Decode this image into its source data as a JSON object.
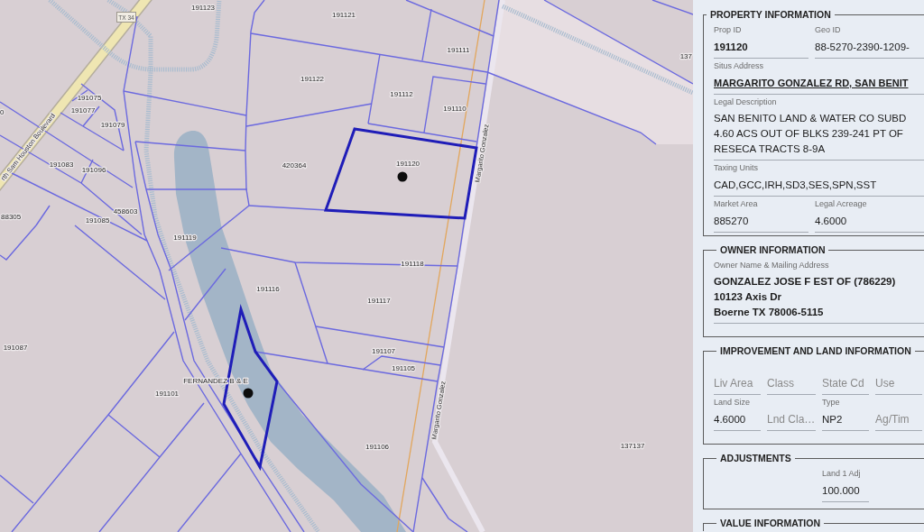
{
  "map": {
    "route_marker": "TX 34",
    "roads": [
      "rth Sam Houston Boulevard",
      "Margarito Gonzalez",
      "Margarito Gonzalez"
    ],
    "parcels": [
      {
        "label": "191123",
        "selected": false
      },
      {
        "label": "191121",
        "selected": false
      },
      {
        "label": "191111",
        "selected": false
      },
      {
        "label": "137",
        "selected": false
      },
      {
        "label": "191122",
        "selected": false
      },
      {
        "label": "191075",
        "selected": false
      },
      {
        "label": "191112",
        "selected": false
      },
      {
        "label": "0",
        "selected": false
      },
      {
        "label": "191077",
        "selected": false
      },
      {
        "label": "191110",
        "selected": false
      },
      {
        "label": "191079",
        "selected": false
      },
      {
        "label": "191083",
        "selected": false
      },
      {
        "label": "191096",
        "selected": false
      },
      {
        "label": "420364",
        "selected": false
      },
      {
        "label": "191120",
        "selected": true
      },
      {
        "label": "88305",
        "selected": false
      },
      {
        "label": "458603",
        "selected": false
      },
      {
        "label": "191085",
        "selected": false
      },
      {
        "label": "191119",
        "selected": false
      },
      {
        "label": "191118",
        "selected": false
      },
      {
        "label": "191116",
        "selected": false
      },
      {
        "label": "191117",
        "selected": false
      },
      {
        "label": "191087",
        "selected": false
      },
      {
        "label": "191107",
        "selected": false
      },
      {
        "label": "191105",
        "selected": false
      },
      {
        "label": "FERNANDEZ B & E",
        "selected": true
      },
      {
        "label": "191101",
        "selected": false
      },
      {
        "label": "191106",
        "selected": false
      },
      {
        "label": "137137",
        "selected": false
      }
    ]
  },
  "panel": {
    "sections": [
      {
        "title": "PROPERTY INFORMATION",
        "rows": [
          [
            {
              "label": "Prop ID",
              "value": "191120",
              "kind": "bold"
            },
            {
              "label": "Geo ID",
              "value": "88-5270-2390-1209-",
              "kind": "plain"
            }
          ],
          [
            {
              "label": "Situs Address",
              "value": "MARGARITO GONZALEZ RD, SAN BENIT",
              "kind": "link"
            }
          ],
          [
            {
              "label": "Legal Description",
              "lines": [
                "SAN BENITO LAND & WATER CO SUBD",
                "4.60 ACS OUT OF BLKS 239-241 PT OF",
                "RESECA TRACTS 8-9A"
              ],
              "kind": "plain"
            }
          ],
          [
            {
              "label": "Taxing Units",
              "value": "CAD,GCC,IRH,SD3,SES,SPN,SST",
              "kind": "plain"
            }
          ],
          [
            {
              "label": "Market Area",
              "value": "885270",
              "kind": "plain"
            },
            {
              "label": "Legal Acreage",
              "value": "4.6000",
              "kind": "plain"
            }
          ]
        ]
      },
      {
        "title": "OWNER INFORMATION",
        "rows": [
          [
            {
              "label": "Owner Name & Mailing Address",
              "lines": [
                "GONZALEZ JOSE F EST OF (786229)",
                "10123 Axis Dr",
                "Boerne TX 78006-5115"
              ],
              "kind": "bold"
            }
          ]
        ]
      },
      {
        "title": "IMPROVEMENT AND LAND INFORMATION",
        "rows": [
          [
            {
              "label": "Liv Area"
            },
            {
              "label": "Class"
            },
            {
              "label": "State Cd"
            },
            {
              "label": "Use"
            }
          ],
          [
            {
              "label": "Land Size",
              "value": "4.6000",
              "kind": "plain"
            },
            {
              "label": "Lnd Cla…"
            },
            {
              "label": "Type",
              "value": "NP2",
              "kind": "plain"
            },
            {
              "label": "Ag/Tim"
            }
          ]
        ]
      },
      {
        "title": "ADJUSTMENTS",
        "rows": [
          [
            {
              "label": "Land 1 Adj",
              "value": "100.000",
              "kind": "plain"
            }
          ]
        ]
      },
      {
        "title": "VALUE INFORMATION"
      }
    ]
  }
}
